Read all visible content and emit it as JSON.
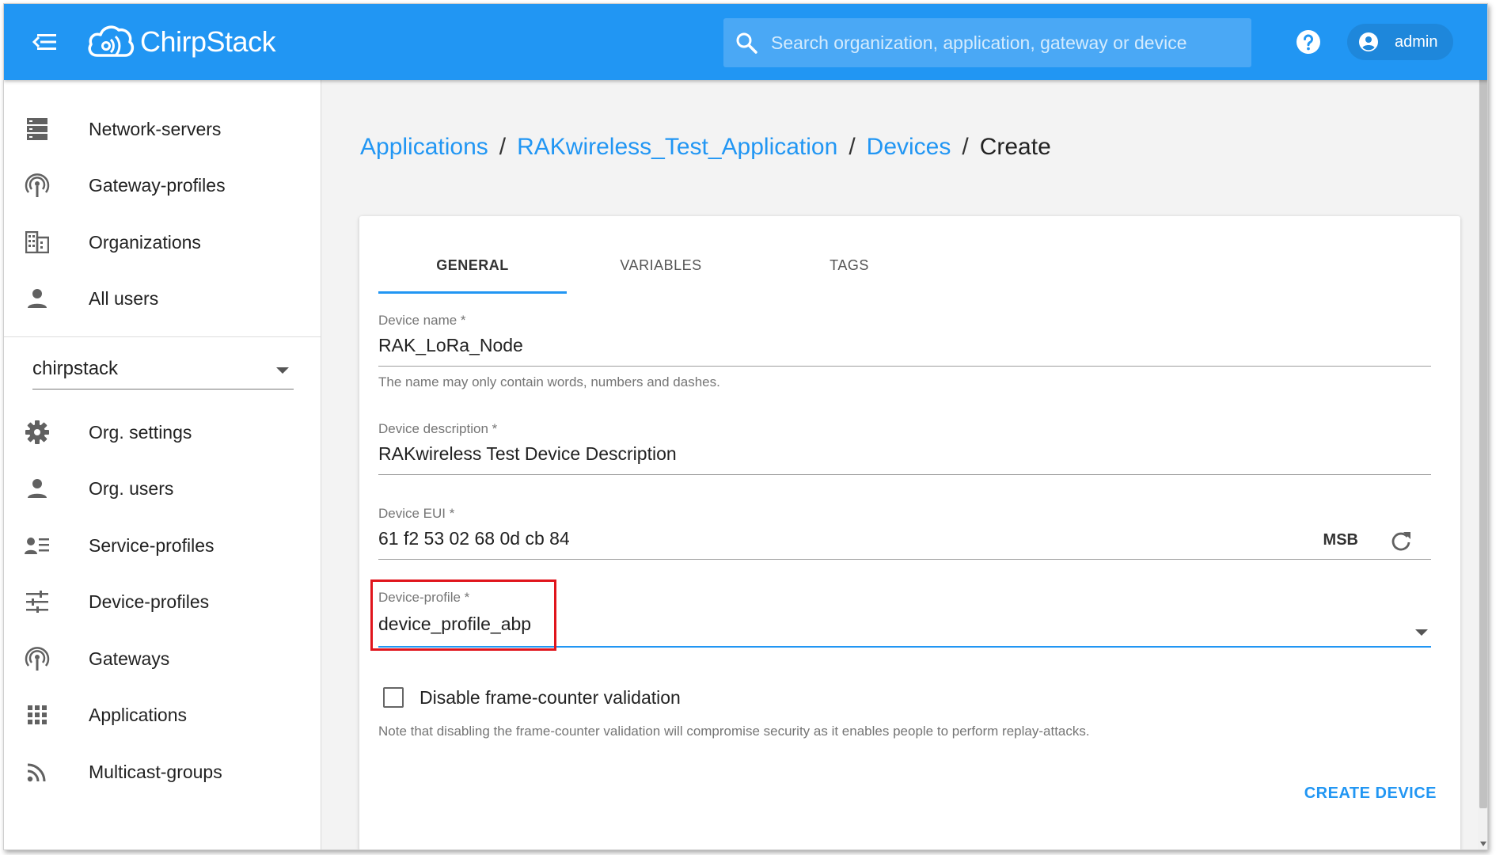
{
  "header": {
    "app_name": "ChirpStack",
    "search_placeholder": "Search organization, application, gateway or device",
    "user_name": "admin"
  },
  "sidebar": {
    "admin_items": [
      {
        "label": "Network-servers",
        "icon": "server-icon"
      },
      {
        "label": "Gateway-profiles",
        "icon": "antenna-icon"
      },
      {
        "label": "Organizations",
        "icon": "building-icon"
      },
      {
        "label": "All users",
        "icon": "person-icon"
      }
    ],
    "organization": "chirpstack",
    "org_items": [
      {
        "label": "Org. settings",
        "icon": "gear-icon"
      },
      {
        "label": "Org. users",
        "icon": "person-icon"
      },
      {
        "label": "Service-profiles",
        "icon": "profile-list-icon"
      },
      {
        "label": "Device-profiles",
        "icon": "tune-icon"
      },
      {
        "label": "Gateways",
        "icon": "antenna-icon"
      },
      {
        "label": "Applications",
        "icon": "grid-icon"
      },
      {
        "label": "Multicast-groups",
        "icon": "rss-icon"
      }
    ]
  },
  "breadcrumb": {
    "items": [
      "Applications",
      "RAKwireless_Test_Application",
      "Devices"
    ],
    "current": "Create",
    "separator": "/"
  },
  "tabs": [
    "GENERAL",
    "VARIABLES",
    "TAGS"
  ],
  "form": {
    "device_name": {
      "label": "Device name *",
      "value": "RAK_LoRa_Node",
      "help": "The name may only contain words, numbers and dashes."
    },
    "device_description": {
      "label": "Device description *",
      "value": "RAKwireless Test Device Description"
    },
    "device_eui": {
      "label": "Device EUI *",
      "value": "61 f2 53 02 68 0d cb 84",
      "byte_order": "MSB"
    },
    "device_profile": {
      "label": "Device-profile *",
      "value": "device_profile_abp"
    },
    "disable_fcnt": {
      "label": "Disable frame-counter validation",
      "checked": false,
      "note": "Note that disabling the frame-counter validation will compromise security as it enables people to perform replay-attacks."
    },
    "submit_label": "CREATE DEVICE"
  },
  "colors": {
    "primary": "#2196f3",
    "highlight": "#e0151c"
  }
}
